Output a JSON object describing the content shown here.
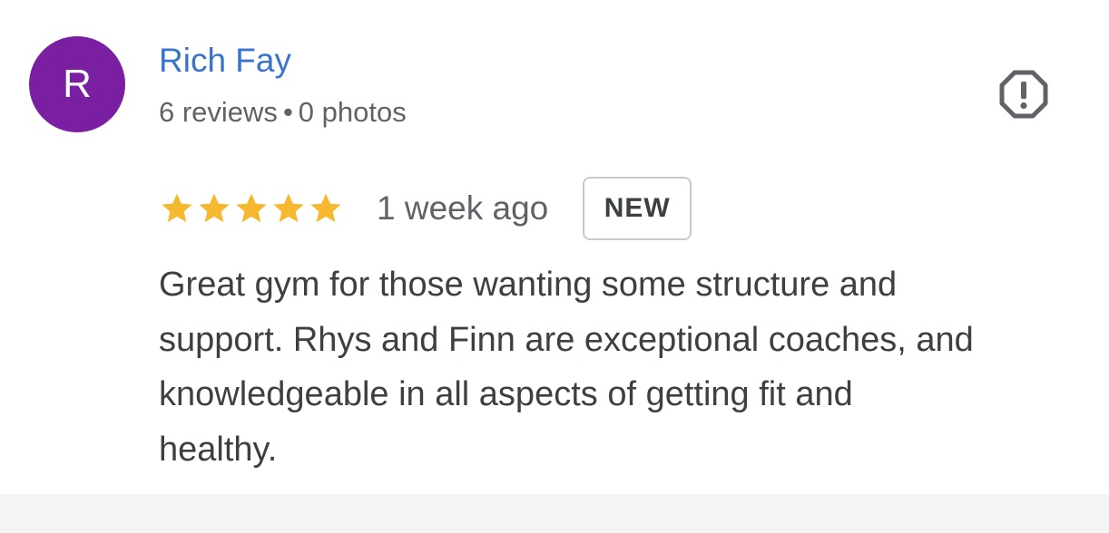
{
  "author": {
    "avatar_initial": "R",
    "avatar_color": "#7b1fa2",
    "name": "Rich Fay",
    "name_color": "#3873cc",
    "reviews_count": "6 reviews",
    "separator": "•",
    "photos_count": "0 photos"
  },
  "report": {
    "icon": "report-octagon-icon"
  },
  "rating": {
    "stars": 5,
    "max_stars": 5,
    "star_color": "#f5b82e",
    "time_ago": "1 week ago",
    "badge": "NEW"
  },
  "review": {
    "text_lines": [
      "Great gym for those wanting some structure and",
      "support. Rhys and Finn are exceptional coaches, and",
      "knowledgeable in all aspects of getting fit and",
      "healthy."
    ]
  }
}
